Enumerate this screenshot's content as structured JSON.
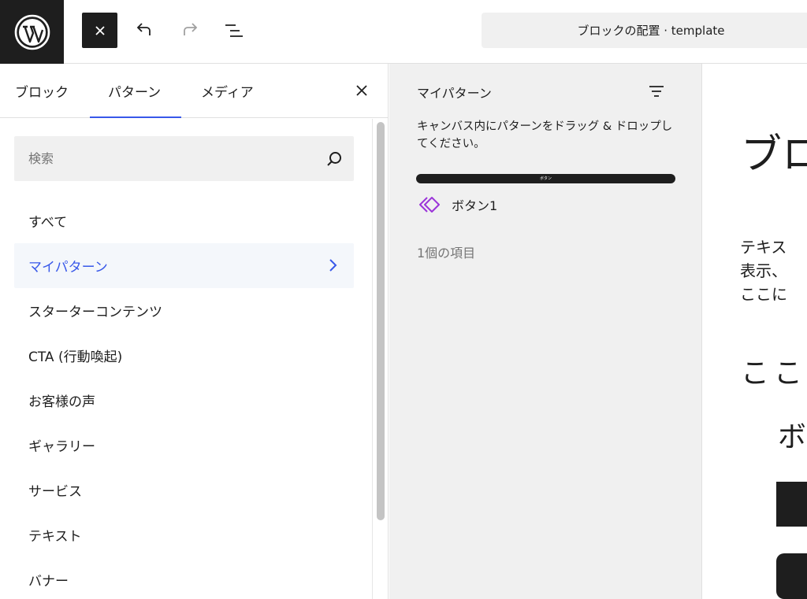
{
  "topbar": {
    "document_title": "ブロックの配置 · template"
  },
  "inserter": {
    "tabs": [
      {
        "label": "ブロック"
      },
      {
        "label": "パターン"
      },
      {
        "label": "メディア"
      }
    ],
    "active_tab": "パターン",
    "search": {
      "placeholder": "検索",
      "value": ""
    },
    "categories": [
      {
        "label": "すべて"
      },
      {
        "label": "マイパターン"
      },
      {
        "label": "スターターコンテンツ"
      },
      {
        "label": "CTA (行動喚起)"
      },
      {
        "label": "お客様の声"
      },
      {
        "label": "ギャラリー"
      },
      {
        "label": "サービス"
      },
      {
        "label": "テキスト"
      },
      {
        "label": "バナー"
      }
    ],
    "active_category": "マイパターン"
  },
  "patterns_panel": {
    "title": "マイパターン",
    "hint": "キャンバス内にパターンをドラッグ & ドロップしてください。",
    "preview_text": "ボタン",
    "item_label": "ボタン1",
    "count_text": "1個の項目"
  },
  "canvas": {
    "heading": "ブロ",
    "paragraph_lines": [
      "テキス",
      "表示、",
      "ここに"
    ],
    "subheading": "ここ",
    "subheading2": "ボ"
  },
  "colors": {
    "accent": "#3858e9",
    "synced_pattern": "#9b34d9",
    "dark": "#1e1e1e"
  }
}
